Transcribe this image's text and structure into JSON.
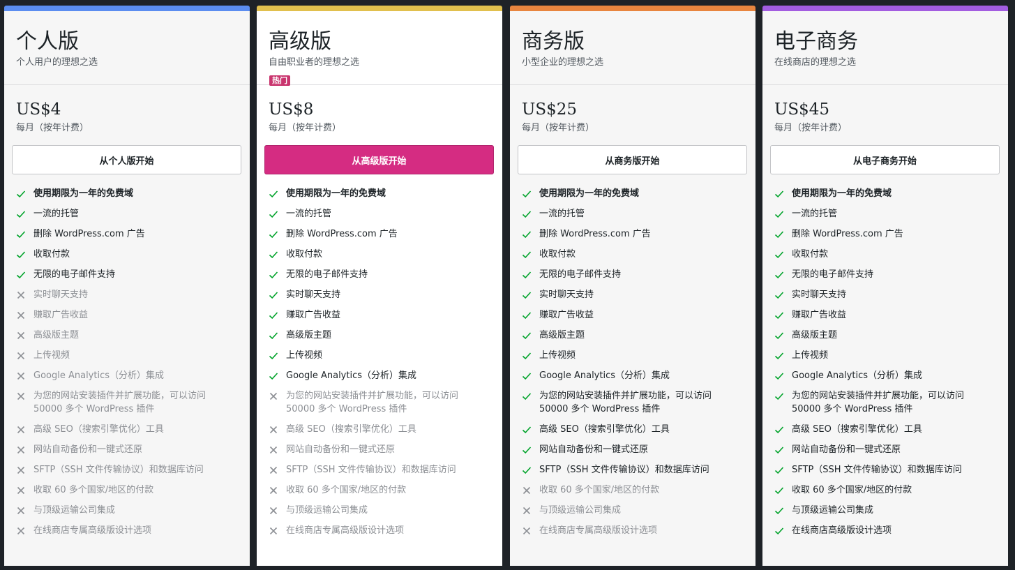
{
  "plans": [
    {
      "name": "个人版",
      "tagline": "个人用户的理想之选",
      "badge": "",
      "price": "US$4",
      "billing": "每月（按年计费）",
      "cta": "从个人版开始",
      "accent": "#5b8df0",
      "primary": false,
      "features": [
        {
          "text": "使用期限为一年的免费域",
          "included": true,
          "bold": true
        },
        {
          "text": "一流的托管",
          "included": true,
          "bold": false
        },
        {
          "text": "删除 WordPress.com 广告",
          "included": true,
          "bold": false
        },
        {
          "text": "收取付款",
          "included": true,
          "bold": false
        },
        {
          "text": "无限的电子邮件支持",
          "included": true,
          "bold": false
        },
        {
          "text": "实时聊天支持",
          "included": false,
          "bold": false
        },
        {
          "text": "赚取广告收益",
          "included": false,
          "bold": false
        },
        {
          "text": "高级版主题",
          "included": false,
          "bold": false
        },
        {
          "text": "上传视频",
          "included": false,
          "bold": false
        },
        {
          "text": "Google Analytics（分析）集成",
          "included": false,
          "bold": false
        },
        {
          "text": "为您的网站安装插件并扩展功能，可以访问 50000 多个 WordPress 插件",
          "included": false,
          "bold": false
        },
        {
          "text": "高级 SEO（搜索引擎优化）工具",
          "included": false,
          "bold": false
        },
        {
          "text": "网站自动备份和一键式还原",
          "included": false,
          "bold": false
        },
        {
          "text": "SFTP（SSH 文件传输协议）和数据库访问",
          "included": false,
          "bold": false
        },
        {
          "text": "收取 60 多个国家/地区的付款",
          "included": false,
          "bold": false
        },
        {
          "text": "与顶级运输公司集成",
          "included": false,
          "bold": false
        },
        {
          "text": "在线商店专属高级版设计选项",
          "included": false,
          "bold": false
        }
      ]
    },
    {
      "name": "高级版",
      "tagline": "自由职业者的理想之选",
      "badge": "热门",
      "price": "US$8",
      "billing": "每月（按年计费）",
      "cta": "从高级版开始",
      "accent": "#e1c04e",
      "primary": true,
      "features": [
        {
          "text": "使用期限为一年的免费域",
          "included": true,
          "bold": true
        },
        {
          "text": "一流的托管",
          "included": true,
          "bold": false
        },
        {
          "text": "删除 WordPress.com 广告",
          "included": true,
          "bold": false
        },
        {
          "text": "收取付款",
          "included": true,
          "bold": false
        },
        {
          "text": "无限的电子邮件支持",
          "included": true,
          "bold": false
        },
        {
          "text": "实时聊天支持",
          "included": true,
          "bold": false
        },
        {
          "text": "赚取广告收益",
          "included": true,
          "bold": false
        },
        {
          "text": "高级版主题",
          "included": true,
          "bold": false
        },
        {
          "text": "上传视频",
          "included": true,
          "bold": false
        },
        {
          "text": "Google Analytics（分析）集成",
          "included": true,
          "bold": false
        },
        {
          "text": "为您的网站安装插件并扩展功能，可以访问 50000 多个 WordPress 插件",
          "included": false,
          "bold": false
        },
        {
          "text": "高级 SEO（搜索引擎优化）工具",
          "included": false,
          "bold": false
        },
        {
          "text": "网站自动备份和一键式还原",
          "included": false,
          "bold": false
        },
        {
          "text": "SFTP（SSH 文件传输协议）和数据库访问",
          "included": false,
          "bold": false
        },
        {
          "text": "收取 60 多个国家/地区的付款",
          "included": false,
          "bold": false
        },
        {
          "text": "与顶级运输公司集成",
          "included": false,
          "bold": false
        },
        {
          "text": "在线商店专属高级版设计选项",
          "included": false,
          "bold": false
        }
      ]
    },
    {
      "name": "商务版",
      "tagline": "小型企业的理想之选",
      "badge": "",
      "price": "US$25",
      "billing": "每月（按年计费）",
      "cta": "从商务版开始",
      "accent": "#e8853f",
      "primary": false,
      "features": [
        {
          "text": "使用期限为一年的免费域",
          "included": true,
          "bold": true
        },
        {
          "text": "一流的托管",
          "included": true,
          "bold": false
        },
        {
          "text": "删除 WordPress.com 广告",
          "included": true,
          "bold": false
        },
        {
          "text": "收取付款",
          "included": true,
          "bold": false
        },
        {
          "text": "无限的电子邮件支持",
          "included": true,
          "bold": false
        },
        {
          "text": "实时聊天支持",
          "included": true,
          "bold": false
        },
        {
          "text": "赚取广告收益",
          "included": true,
          "bold": false
        },
        {
          "text": "高级版主题",
          "included": true,
          "bold": false
        },
        {
          "text": "上传视频",
          "included": true,
          "bold": false
        },
        {
          "text": "Google Analytics（分析）集成",
          "included": true,
          "bold": false
        },
        {
          "text": "为您的网站安装插件并扩展功能，可以访问 50000 多个 WordPress 插件",
          "included": true,
          "bold": false
        },
        {
          "text": "高级 SEO（搜索引擎优化）工具",
          "included": true,
          "bold": false
        },
        {
          "text": "网站自动备份和一键式还原",
          "included": true,
          "bold": false
        },
        {
          "text": "SFTP（SSH 文件传输协议）和数据库访问",
          "included": true,
          "bold": false
        },
        {
          "text": "收取 60 多个国家/地区的付款",
          "included": false,
          "bold": false
        },
        {
          "text": "与顶级运输公司集成",
          "included": false,
          "bold": false
        },
        {
          "text": "在线商店专属高级版设计选项",
          "included": false,
          "bold": false
        }
      ]
    },
    {
      "name": "电子商务",
      "tagline": "在线商店的理想之选",
      "badge": "",
      "price": "US$45",
      "billing": "每月（按年计费）",
      "cta": "从电子商务开始",
      "accent": "#a35de0",
      "primary": false,
      "features": [
        {
          "text": "使用期限为一年的免费域",
          "included": true,
          "bold": true
        },
        {
          "text": "一流的托管",
          "included": true,
          "bold": false
        },
        {
          "text": "删除 WordPress.com 广告",
          "included": true,
          "bold": false
        },
        {
          "text": "收取付款",
          "included": true,
          "bold": false
        },
        {
          "text": "无限的电子邮件支持",
          "included": true,
          "bold": false
        },
        {
          "text": "实时聊天支持",
          "included": true,
          "bold": false
        },
        {
          "text": "赚取广告收益",
          "included": true,
          "bold": false
        },
        {
          "text": "高级版主题",
          "included": true,
          "bold": false
        },
        {
          "text": "上传视频",
          "included": true,
          "bold": false
        },
        {
          "text": "Google Analytics（分析）集成",
          "included": true,
          "bold": false
        },
        {
          "text": "为您的网站安装插件并扩展功能，可以访问 50000 多个 WordPress 插件",
          "included": true,
          "bold": false
        },
        {
          "text": "高级 SEO（搜索引擎优化）工具",
          "included": true,
          "bold": false
        },
        {
          "text": "网站自动备份和一键式还原",
          "included": true,
          "bold": false
        },
        {
          "text": "SFTP（SSH 文件传输协议）和数据库访问",
          "included": true,
          "bold": false
        },
        {
          "text": "收取 60 多个国家/地区的付款",
          "included": true,
          "bold": false
        },
        {
          "text": "与顶级运输公司集成",
          "included": true,
          "bold": false
        },
        {
          "text": "在线商店高级版设计选项",
          "included": true,
          "bold": false
        }
      ]
    }
  ],
  "colors": {
    "check": "#00a32a",
    "cross": "#8c8f94",
    "primary_button": "#d52c82",
    "badge": "#c9356e"
  },
  "icons": {
    "included": "check-icon",
    "excluded": "cross-icon"
  }
}
